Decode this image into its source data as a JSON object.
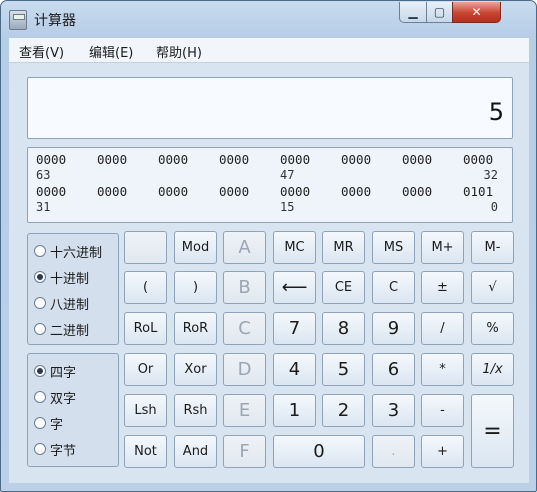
{
  "window": {
    "title": "计算器",
    "controls": {
      "minimize": "▁",
      "maximize": "▢",
      "close": "✕"
    }
  },
  "menu": [
    "查看(V)",
    "编辑(E)",
    "帮助(H)"
  ],
  "display": {
    "value": "5"
  },
  "binary": {
    "row1_groups": [
      "0000",
      "0000",
      "0000",
      "0000",
      "0000",
      "0000",
      "0000",
      "0000"
    ],
    "row1_index": {
      "left": "63",
      "mid": "47",
      "right": "32"
    },
    "row2_groups": [
      "0000",
      "0000",
      "0000",
      "0000",
      "0000",
      "0000",
      "0000",
      "0101"
    ],
    "row2_index": {
      "left": "31",
      "mid": "15",
      "right": "0"
    }
  },
  "base_options": [
    {
      "label": "十六进制",
      "selected": false
    },
    {
      "label": "十进制",
      "selected": true
    },
    {
      "label": "八进制",
      "selected": false
    },
    {
      "label": "二进制",
      "selected": false
    }
  ],
  "word_options": [
    {
      "label": "四字",
      "selected": true
    },
    {
      "label": "双字",
      "selected": false
    },
    {
      "label": "字",
      "selected": false
    },
    {
      "label": "字节",
      "selected": false
    }
  ],
  "buttons": {
    "blank": "",
    "mod": "Mod",
    "a": "A",
    "mc": "MC",
    "mr": "MR",
    "ms": "MS",
    "mplus": "M+",
    "mminus": "M-",
    "lparen": "(",
    "rparen": ")",
    "b": "B",
    "backspace": "⟵",
    "ce": "CE",
    "c": "C",
    "plusminus": "±",
    "sqrt": "√",
    "rol": "RoL",
    "ror": "RoR",
    "hc": "C",
    "d7": "7",
    "d8": "8",
    "d9": "9",
    "divide": "/",
    "percent": "%",
    "or": "Or",
    "xor": "Xor",
    "d": "D",
    "d4": "4",
    "d5": "5",
    "d6": "6",
    "multiply": "*",
    "reciprocal": "1/x",
    "lsh": "Lsh",
    "rsh": "Rsh",
    "e": "E",
    "d1": "1",
    "d2": "2",
    "d3": "3",
    "minus": "-",
    "equals": "=",
    "not": "Not",
    "and": "And",
    "f": "F",
    "d0": "0",
    "dot": ".",
    "plus": "+"
  }
}
